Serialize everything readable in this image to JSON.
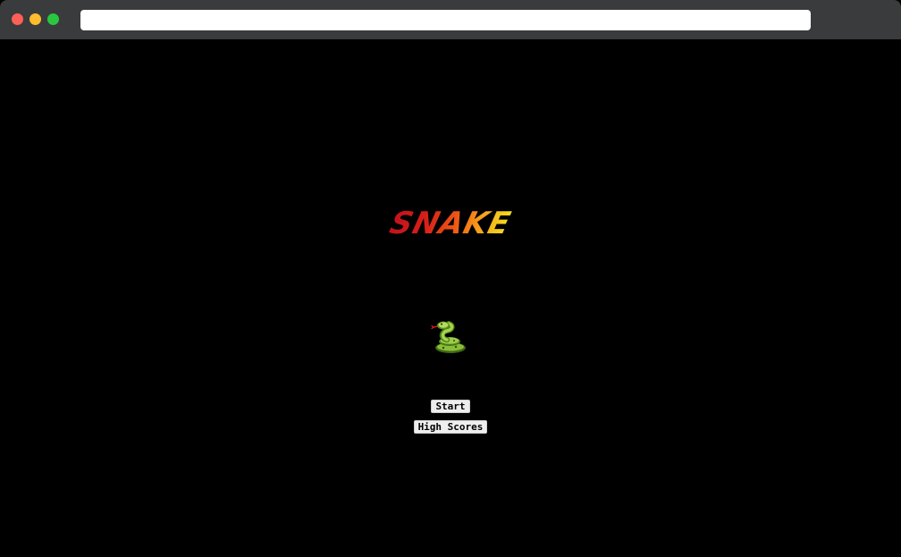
{
  "browser": {
    "url_value": ""
  },
  "game": {
    "title": "SNAKE",
    "mascot_icon": "snake-icon",
    "menu": {
      "start_label": "Start",
      "high_scores_label": "High Scores"
    }
  },
  "colors": {
    "background": "#000000",
    "title_gradient_start": "#c0121c",
    "title_gradient_end": "#f4e21e",
    "button_bg": "#eeeeee"
  }
}
